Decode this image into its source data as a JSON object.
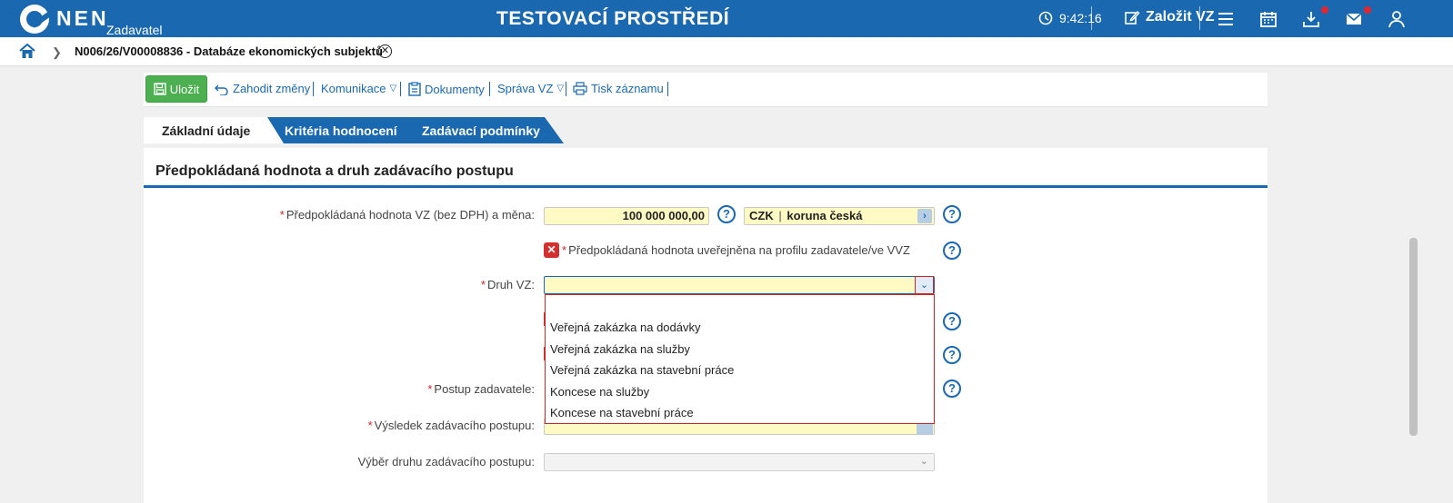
{
  "header": {
    "logo_text": "NEN",
    "logo_sub": "Zadavatel",
    "app_title": "TESTOVACÍ PROSTŘEDÍ",
    "time": "9:42:16",
    "create_label": "Založit VZ",
    "icons": [
      "clock-icon",
      "edit-icon",
      "menu-icon",
      "calendar-icon",
      "download-icon",
      "mail-icon",
      "user-icon"
    ],
    "notification_color": "#e4252e"
  },
  "breadcrumb": {
    "path": "N006/26/V00008836 - Databáze ekonomických subjektů"
  },
  "toolbar": {
    "save_label": "Uložit",
    "discard_label": "Zahodit změny",
    "communication_label": "Komunikace",
    "documents_label": "Dokumenty",
    "manage_label": "Správa VZ",
    "print_label": "Tisk záznamu"
  },
  "tabs": [
    {
      "label": "Základní údaje",
      "active": true
    },
    {
      "label": "Kritéria hodnocení",
      "active": false
    },
    {
      "label": "Zadávací podmínky",
      "active": false
    }
  ],
  "section": {
    "title": "Předpokládaná hodnota a druh zadávacího postupu"
  },
  "form": {
    "value_label": "Předpokládaná hodnota VZ (bez DPH) a měna:",
    "value": "100 000 000,00",
    "currency_code": "CZK",
    "currency_separator": "|",
    "currency_name": "koruna česká",
    "published_label": "Předpokládaná hodnota uveřejněna na profilu zadavatele/ve VVZ",
    "type_label": "Druh VZ:",
    "type_value": "",
    "procedure_label": "Postup zadavatele:",
    "result_label": "Výsledek zadávacího postupu:",
    "procedure_kind_label": "Výběr druhu zadávacího postupu:",
    "help_symbol": "?"
  },
  "dropdown": {
    "options": [
      "",
      "Veřejná zakázka na dodávky",
      "Veřejná zakázka na služby",
      "Veřejná zakázka na stavební práce",
      "Koncese na služby",
      "Koncese na stavební práce"
    ]
  },
  "colors": {
    "brand": "#1a69b0",
    "save": "#4caf50",
    "required": "#c62828",
    "field_bg": "#fff9c4"
  }
}
